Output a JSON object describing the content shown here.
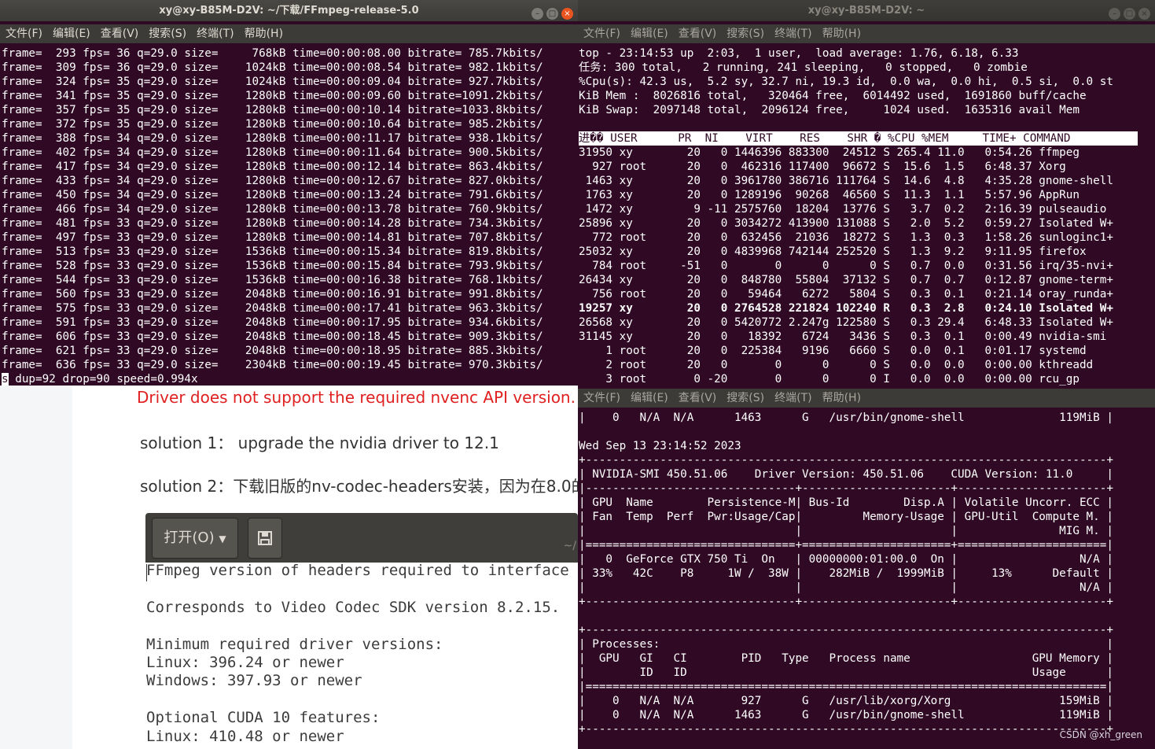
{
  "menu": [
    "文件(F)",
    "编辑(E)",
    "查看(V)",
    "搜索(S)",
    "终端(T)",
    "帮助(H)"
  ],
  "win_left": {
    "title": "xy@xy-B85M-D2V: ~/下载/FFmpeg-release-5.0",
    "lines": [
      "frame=  293 fps= 36 q=29.0 size=     768kB time=00:00:08.00 bitrate= 785.7kbits/",
      "frame=  309 fps= 36 q=29.0 size=    1024kB time=00:00:08.54 bitrate= 982.1kbits/",
      "frame=  324 fps= 35 q=29.0 size=    1024kB time=00:00:09.04 bitrate= 927.7kbits/",
      "frame=  341 fps= 35 q=29.0 size=    1280kB time=00:00:09.60 bitrate=1091.2kbits/",
      "frame=  357 fps= 35 q=29.0 size=    1280kB time=00:00:10.14 bitrate=1033.8kbits/",
      "frame=  372 fps= 35 q=29.0 size=    1280kB time=00:00:10.64 bitrate= 985.2kbits/",
      "frame=  388 fps= 34 q=29.0 size=    1280kB time=00:00:11.17 bitrate= 938.1kbits/",
      "frame=  402 fps= 34 q=29.0 size=    1280kB time=00:00:11.64 bitrate= 900.5kbits/",
      "frame=  417 fps= 34 q=29.0 size=    1280kB time=00:00:12.14 bitrate= 863.4kbits/",
      "frame=  433 fps= 34 q=29.0 size=    1280kB time=00:00:12.67 bitrate= 827.0kbits/",
      "frame=  450 fps= 34 q=29.0 size=    1280kB time=00:00:13.24 bitrate= 791.6kbits/",
      "frame=  466 fps= 34 q=29.0 size=    1280kB time=00:00:13.78 bitrate= 760.9kbits/",
      "frame=  481 fps= 33 q=29.0 size=    1280kB time=00:00:14.28 bitrate= 734.3kbits/",
      "frame=  497 fps= 33 q=29.0 size=    1280kB time=00:00:14.81 bitrate= 707.8kbits/",
      "frame=  513 fps= 33 q=29.0 size=    1536kB time=00:00:15.34 bitrate= 819.8kbits/",
      "frame=  528 fps= 33 q=29.0 size=    1536kB time=00:00:15.84 bitrate= 793.9kbits/",
      "frame=  544 fps= 33 q=29.0 size=    1536kB time=00:00:16.38 bitrate= 768.1kbits/",
      "frame=  560 fps= 33 q=29.0 size=    2048kB time=00:00:16.91 bitrate= 991.8kbits/",
      "frame=  575 fps= 33 q=29.0 size=    2048kB time=00:00:17.41 bitrate= 963.3kbits/",
      "frame=  591 fps= 33 q=29.0 size=    2048kB time=00:00:17.95 bitrate= 934.6kbits/",
      "frame=  606 fps= 33 q=29.0 size=    2048kB time=00:00:18.45 bitrate= 909.3kbits/",
      "frame=  621 fps= 33 q=29.0 size=    2048kB time=00:00:18.95 bitrate= 885.3kbits/",
      "frame=  636 fps= 33 q=29.0 size=    2304kB time=00:00:19.45 bitrate= 970.3kbits/"
    ],
    "cursor_char": "s",
    "last_line": " dup=92 drop=90 speed=0.994x"
  },
  "win_top": {
    "title": "xy@xy-B85M-D2V: ~",
    "summary": [
      "top - 23:14:53 up  2:03,  1 user,  load average: 1.76, 6.18, 6.33",
      "任务: 300 total,   2 running, 241 sleeping,   0 stopped,   0 zombie",
      "%Cpu(s): 42.3 us,  5.2 sy, 32.7 ni, 19.3 id,  0.0 wa,  0.0 hi,  0.5 si,  0.0 st",
      "KiB Mem :  8026816 total,   320464 free,  6014492 used,  1691860 buff/cache",
      "KiB Swap:  2097148 total,  2096124 free,     1024 used.  1635316 avail Mem"
    ],
    "header": "进�� USER      PR  NI    VIRT    RES    SHR � %CPU %MEM     TIME+ COMMAND          ",
    "rows": [
      {
        "text": "31950 xy        20   0 1446396 883300  24512 S 265.4 11.0   0:54.26 ffmpeg",
        "bold": false
      },
      {
        "text": "  927 root      20   0  462316 117400  96672 S  15.6  1.5   6:48.37 Xorg",
        "bold": false
      },
      {
        "text": " 1463 xy        20   0 3961780 386716 111764 S  14.6  4.8   4:35.28 gnome-shell",
        "bold": false
      },
      {
        "text": " 1763 xy        20   0 1289196  90268  46560 S  11.3  1.1   5:57.96 AppRun",
        "bold": false
      },
      {
        "text": " 1472 xy         9 -11 2575760  18204  13776 S   3.7  0.2   2:16.39 pulseaudio",
        "bold": false
      },
      {
        "text": "25896 xy        20   0 3034272 413900 131088 S   2.0  5.2   0:59.27 Isolated W+",
        "bold": false
      },
      {
        "text": "  772 root      20   0  632456  21036  18272 S   1.3  0.3   1:58.26 sunloginc1+",
        "bold": false
      },
      {
        "text": "25032 xy        20   0 4839968 742144 252520 S   1.3  9.2   9:11.95 firefox",
        "bold": false
      },
      {
        "text": "  784 root     -51   0       0      0      0 S   0.7  0.0   0:31.56 irq/35-nvi+",
        "bold": false
      },
      {
        "text": "26434 xy        20   0  848780  55804  37132 S   0.7  0.7   0:12.87 gnome-term+",
        "bold": false
      },
      {
        "text": "  756 root      20   0   59464   6272   5804 S   0.3  0.1   0:21.14 oray_runda+",
        "bold": false
      },
      {
        "text": "19257 xy        20   0 2764528 221824 102240 R   0.3  2.8   0:24.10 Isolated W+",
        "bold": true
      },
      {
        "text": "26568 xy        20   0 5420772 2.247g 122580 S   0.3 29.4   6:48.33 Isolated W+",
        "bold": false
      },
      {
        "text": "31145 xy        20   0   18392   6724   3436 S   0.3  0.1   0:00.49 nvidia-smi",
        "bold": false
      },
      {
        "text": "    1 root      20   0  225384   9196   6660 S   0.0  0.1   0:01.17 systemd",
        "bold": false
      },
      {
        "text": "    2 root      20   0       0      0      0 S   0.0  0.0   0:00.00 kthreadd",
        "bold": false
      },
      {
        "text": "    3 root       0 -20       0      0      0 I   0.0  0.0   0:00.00 rcu_gp",
        "bold": false
      }
    ]
  },
  "win_bottom": {
    "lines": [
      "|    0   N/A  N/A      1463      G   /usr/bin/gnome-shell              119MiB |",
      "",
      "Wed Sep 13 23:14:52 2023",
      "+-----------------------------------------------------------------------------+",
      "| NVIDIA-SMI 450.51.06    Driver Version: 450.51.06    CUDA Version: 11.0     |",
      "|-------------------------------+----------------------+----------------------+",
      "| GPU  Name        Persistence-M| Bus-Id        Disp.A | Volatile Uncorr. ECC |",
      "| Fan  Temp  Perf  Pwr:Usage/Cap|         Memory-Usage | GPU-Util  Compute M. |",
      "|                               |                      |               MIG M. |",
      "|===============================+======================+======================|",
      "|   0  GeForce GTX 750 Ti  On   | 00000000:01:00.0  On |                  N/A |",
      "| 33%   42C    P8     1W /  38W |    282MiB /  1999MiB |     13%      Default |",
      "|                               |                      |                  N/A |",
      "+-------------------------------+----------------------+----------------------+",
      "",
      "+-----------------------------------------------------------------------------+",
      "| Processes:                                                                  |",
      "|  GPU   GI   CI        PID   Type   Process name                  GPU Memory |",
      "|        ID   ID                                                   Usage      |",
      "|=============================================================================|",
      "|    0   N/A  N/A       927      G   /usr/lib/xorg/Xorg                159MiB |",
      "|    0   N/A  N/A      1463      G   /usr/bin/gnome-shell              119MiB |",
      "+-----------------------------------------------------------------------------+"
    ]
  },
  "blog": {
    "error_text": "Driver does not support the required nvenc API version. Re",
    "solution1": "solution 1： upgrade the nvidia driver to 12.1",
    "solution2": "solution 2：下载旧版的nv-codec-headers安装，因为在8.0的",
    "open_button": "打开(O)",
    "path_hint": "~/",
    "doc_lines": [
      "FFmpeg version of headers required to interface",
      "",
      "Corresponds to Video Codec SDK version 8.2.15.",
      "",
      "Minimum required driver versions:",
      "Linux: 396.24 or newer",
      "Windows: 397.93 or newer",
      "",
      "Optional CUDA 10 features:",
      "Linux: 410.48 or newer"
    ]
  },
  "watermark": "CSDN @xh_green"
}
